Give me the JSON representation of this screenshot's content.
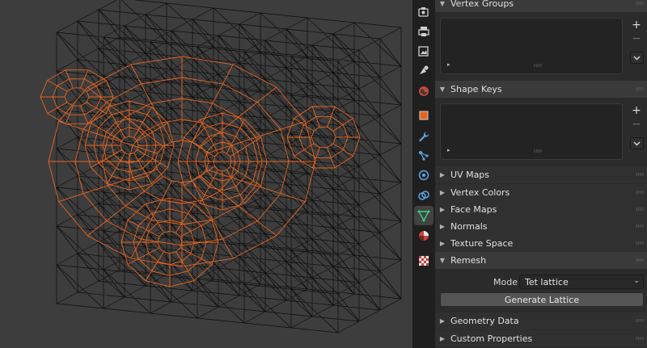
{
  "panels": {
    "vertex_groups": "Vertex Groups",
    "shape_keys": "Shape Keys",
    "uv_maps": "UV Maps",
    "vertex_colors": "Vertex Colors",
    "face_maps": "Face Maps",
    "normals": "Normals",
    "texture_space": "Texture Space",
    "remesh": "Remesh",
    "geometry_data": "Geometry Data",
    "custom_properties": "Custom Properties"
  },
  "remesh": {
    "mode_label": "Mode",
    "mode_value": "Tet lattice",
    "generate_label": "Generate Lattice"
  },
  "list_controls": {
    "add": "+",
    "remove": "−",
    "expand": "▸"
  },
  "colors": {
    "accent": "#e8641d",
    "wire": "#0d0d0d",
    "active_tab_green": "#37d188"
  },
  "icons": [
    "render-icon",
    "output-icon",
    "view-layer-icon",
    "scene-icon",
    "world-icon",
    "object-icon",
    "modifier-icon",
    "particles-icon",
    "physics-icon",
    "constraints-icon",
    "mesh-data-icon",
    "material-icon",
    "texture-icon"
  ]
}
